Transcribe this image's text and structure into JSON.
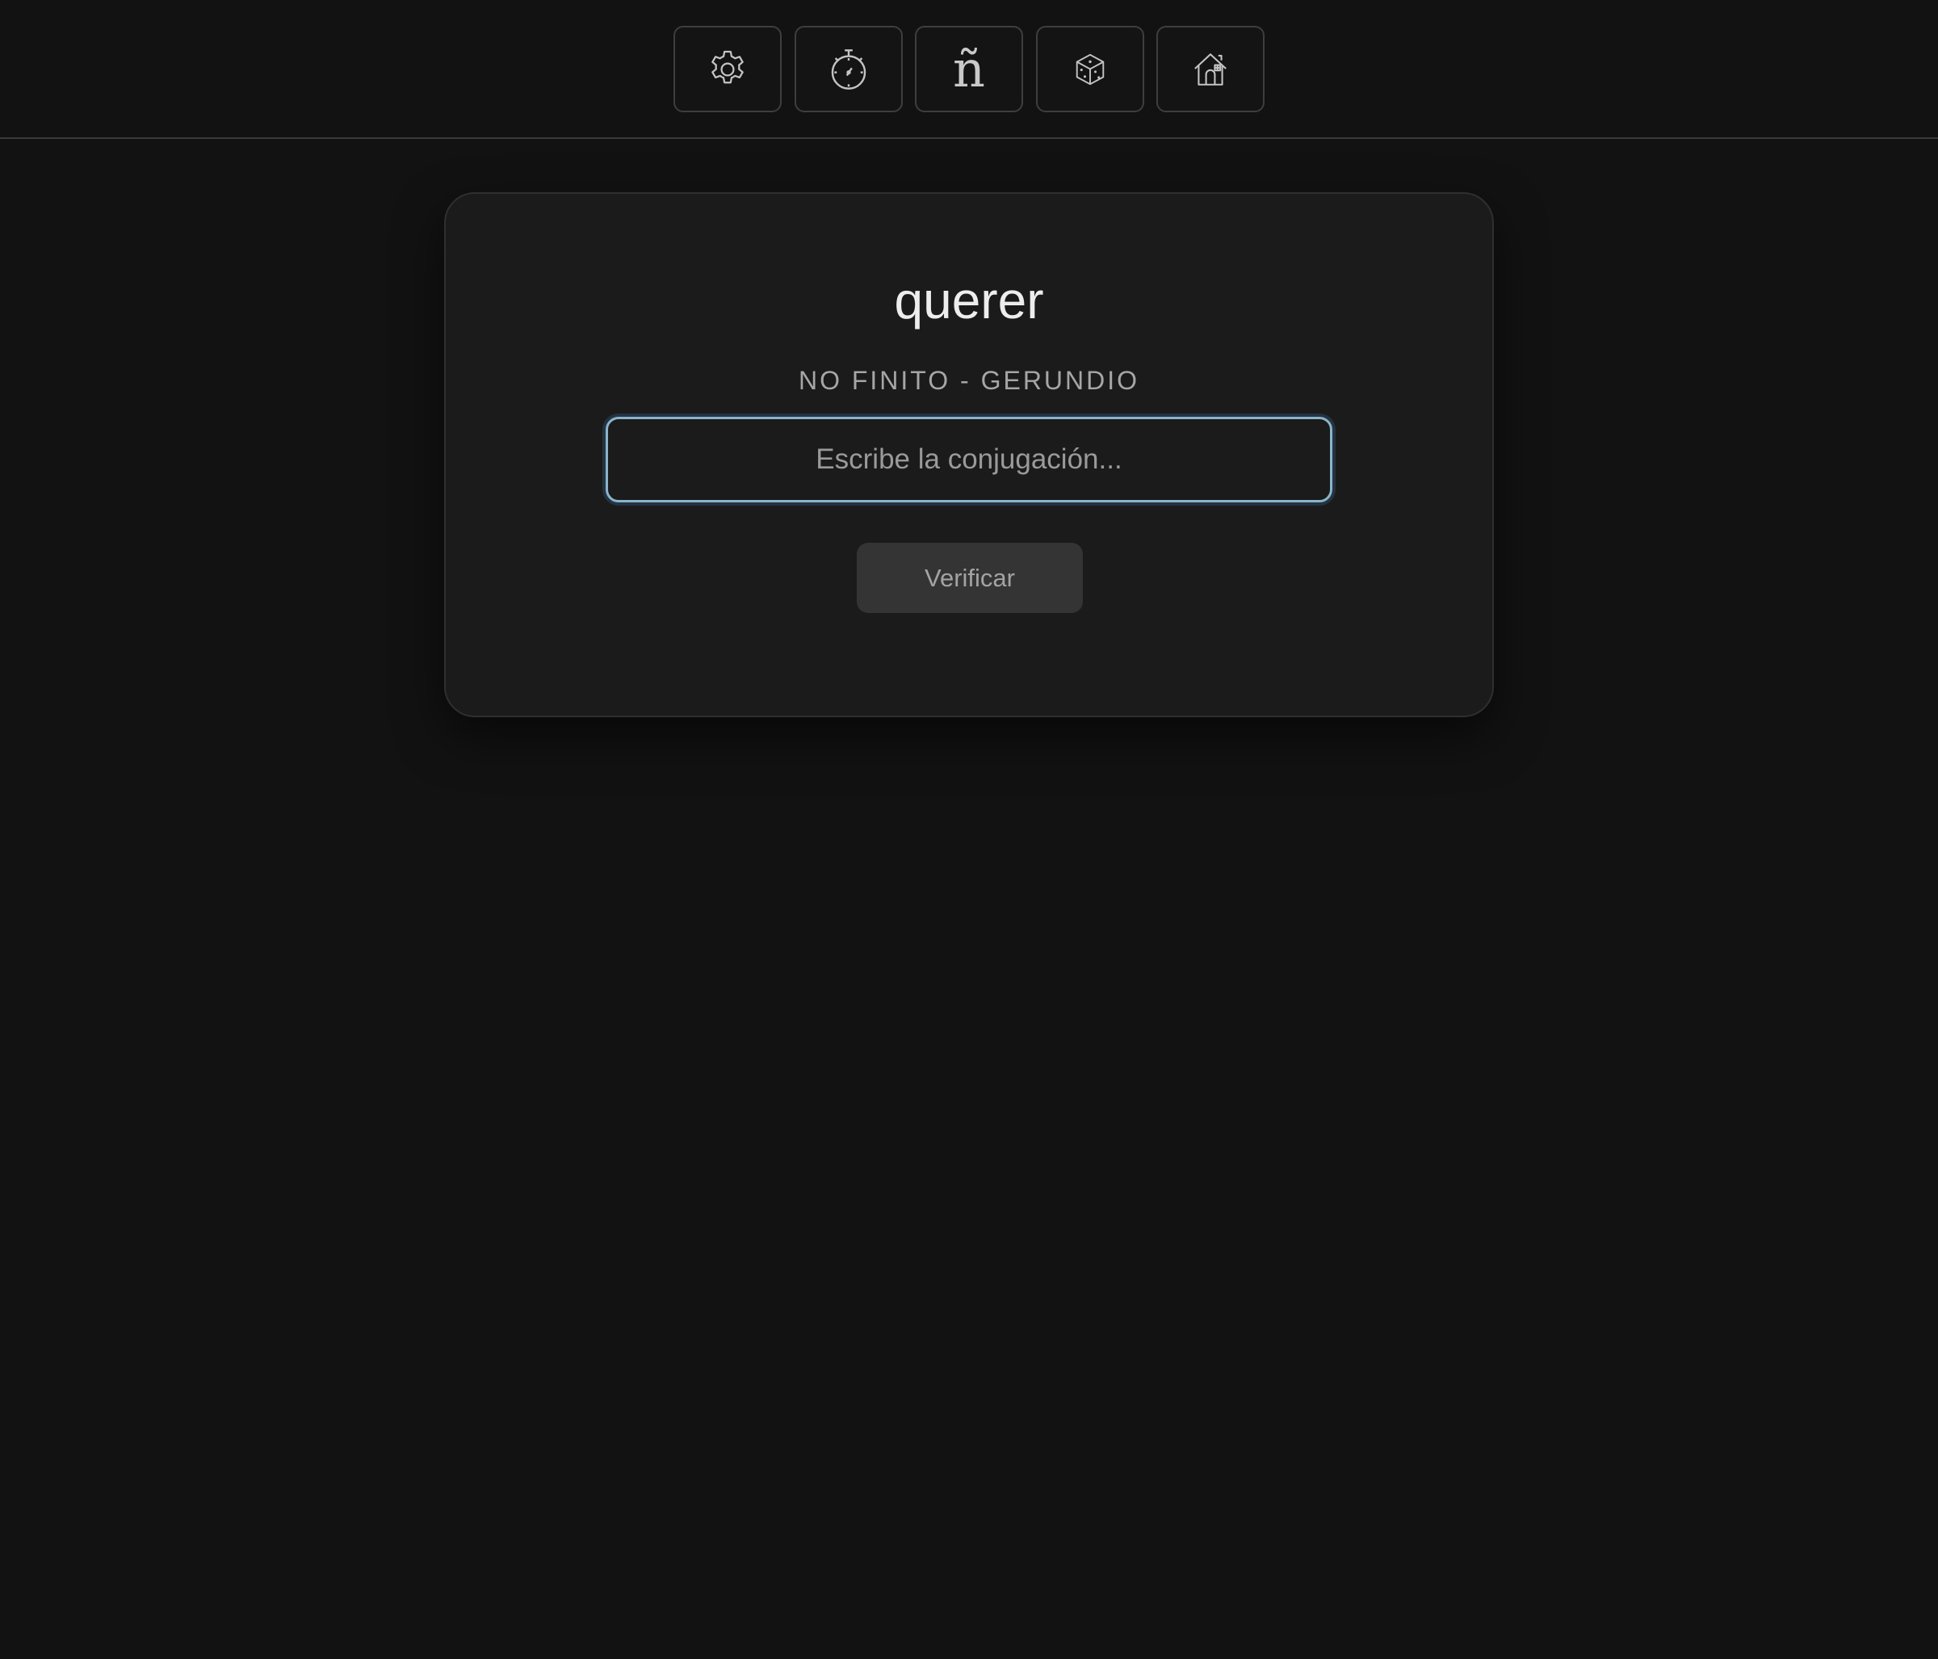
{
  "nav": {
    "buttons": [
      {
        "icon": "gear-icon"
      },
      {
        "icon": "stopwatch-icon"
      },
      {
        "icon": "enye-icon",
        "glyph": "ñ"
      },
      {
        "icon": "dice-icon"
      },
      {
        "icon": "home-icon"
      }
    ]
  },
  "quiz": {
    "verb": "querer",
    "tense": "NO FINITO - GERUNDIO",
    "answer_placeholder": "Escribe la conjugación...",
    "answer_value": "",
    "verify_label": "Verificar"
  },
  "colors": {
    "background": "#121212",
    "card": "#1b1b1b",
    "focus_ring": "#8ab4c9",
    "button": "#343434"
  }
}
